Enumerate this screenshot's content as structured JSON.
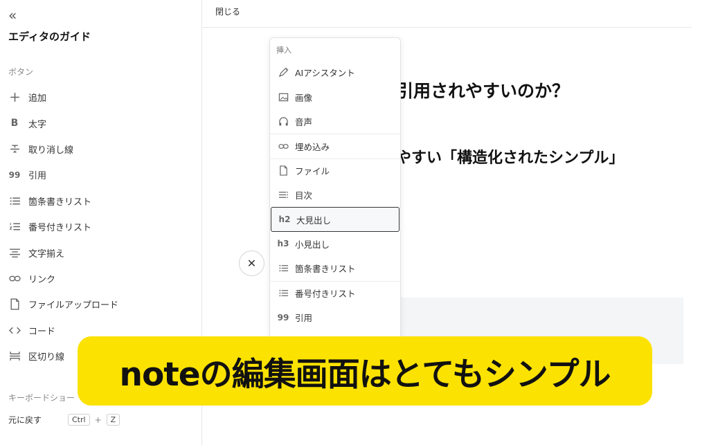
{
  "sidebar": {
    "collapse_glyph": "«",
    "title": "エディタのガイド",
    "section_buttons": "ボタン",
    "items": [
      {
        "label": "追加",
        "icon": "plus-icon"
      },
      {
        "label": "太字",
        "icon": "bold-icon"
      },
      {
        "label": "取り消し線",
        "icon": "strikethrough-icon"
      },
      {
        "label": "引用",
        "icon": "quote-icon"
      },
      {
        "label": "箇条書きリスト",
        "icon": "bullet-list-icon"
      },
      {
        "label": "番号付きリスト",
        "icon": "numbered-list-icon"
      },
      {
        "label": "文字揃え",
        "icon": "align-icon"
      },
      {
        "label": "リンク",
        "icon": "link-icon"
      },
      {
        "label": "ファイルアップロード",
        "icon": "file-icon"
      },
      {
        "label": "コード",
        "icon": "code-icon"
      },
      {
        "label": "区切り線",
        "icon": "divider-icon"
      }
    ],
    "section_keyboard": "キーボードショー",
    "shortcut": {
      "label": "元に戻す",
      "key1": "Ctrl",
      "plus": "+",
      "key2": "Z"
    }
  },
  "topbar": {
    "close_label": "閉じる"
  },
  "editor": {
    "heading_1": "引用されやすいのか？",
    "heading_2": "やすい「構造化されたシンプル」"
  },
  "close_circle": {
    "glyph": "✕"
  },
  "insert_menu": {
    "label": "挿入",
    "items": [
      {
        "label": "AIアシスタント",
        "icon": "pen-icon"
      },
      {
        "label": "画像",
        "icon": "image-icon"
      },
      {
        "label": "音声",
        "icon": "headphones-icon"
      },
      {
        "label": "埋め込み",
        "icon": "link-icon"
      },
      {
        "label": "ファイル",
        "icon": "file-icon"
      },
      {
        "label": "目次",
        "icon": "toc-icon"
      },
      {
        "label": "大見出し",
        "icon": "h2-icon",
        "badge": "h2",
        "selected": true
      },
      {
        "label": "小見出し",
        "icon": "h3-icon",
        "badge": "h3"
      },
      {
        "label": "箇条書きリスト",
        "icon": "bullet-list-icon"
      },
      {
        "label": "番号付きリスト",
        "icon": "numbered-list-icon"
      },
      {
        "label": "引用",
        "icon": "quote-icon",
        "badge": "99"
      }
    ]
  },
  "banner": {
    "text": "noteの編集画面はとてもシンプル"
  },
  "colors": {
    "banner": "#fce200",
    "text": "#111111",
    "border": "#e6e6e6"
  }
}
